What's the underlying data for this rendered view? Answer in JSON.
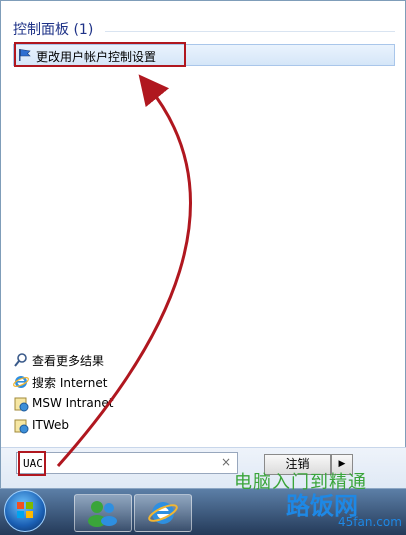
{
  "control_panel": {
    "section_title": "控制面板 (1)",
    "result_label": "更改用户帐户控制设置",
    "result_icon": "uac-flag-icon"
  },
  "links": [
    {
      "label": "查看更多结果",
      "icon": "search-icon"
    },
    {
      "label": "搜索 Internet",
      "icon": "ie-icon"
    },
    {
      "label": "MSW Intranet",
      "icon": "intranet-icon"
    },
    {
      "label": "ITWeb",
      "icon": "web-icon"
    }
  ],
  "search": {
    "value": "UAC",
    "clear_glyph": "×"
  },
  "shutdown": {
    "label": "注销",
    "arrow_glyph": "▶"
  },
  "watermark": {
    "line1": "电脑入门到精通",
    "line2": "路饭网",
    "line3": "45fan.com"
  },
  "colors": {
    "highlight": "#b0171f",
    "arrow": "#b0171f"
  }
}
